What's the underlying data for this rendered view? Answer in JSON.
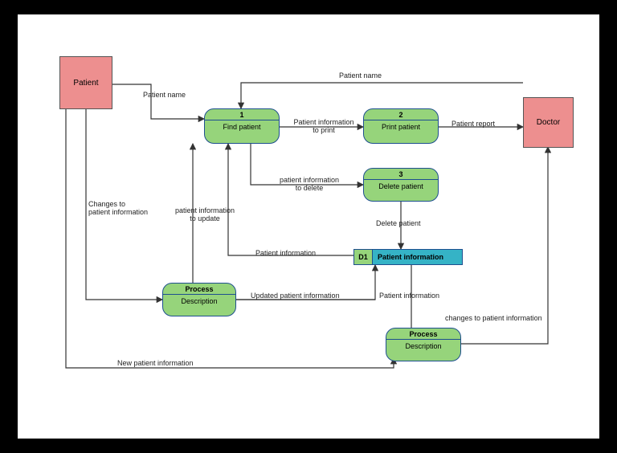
{
  "entities": {
    "patient": "Patient",
    "doctor": "Doctor"
  },
  "processes": {
    "p1": {
      "num": "1",
      "name": "Find patient"
    },
    "p2": {
      "num": "2",
      "name": "Print patient"
    },
    "p3": {
      "num": "3",
      "name": "Delete patient"
    },
    "p4": {
      "num": "Process",
      "name": "Description"
    },
    "p5": {
      "num": "Process",
      "name": "Description"
    }
  },
  "datastore": {
    "id": "D1",
    "name": "Patient information"
  },
  "flows": {
    "patient_to_p1": "Patient name",
    "doctor_to_p1": "Patient name",
    "p1_to_p2": "Patient information\nto print",
    "p2_to_doctor": "Patient report",
    "p1_to_p3": "patient information\nto delete",
    "p3_to_ds": "Delete patient",
    "ds_to_p1": "Patient information",
    "p1_to_p4": "patient information\nto update",
    "patient_to_p4": "Changes to\npatient information",
    "p4_to_ds": "Updated patient information",
    "ds_to_p5": "Patient information",
    "p5_to_doctor": "changes to patient information",
    "patient_to_p5": "New patient information"
  }
}
